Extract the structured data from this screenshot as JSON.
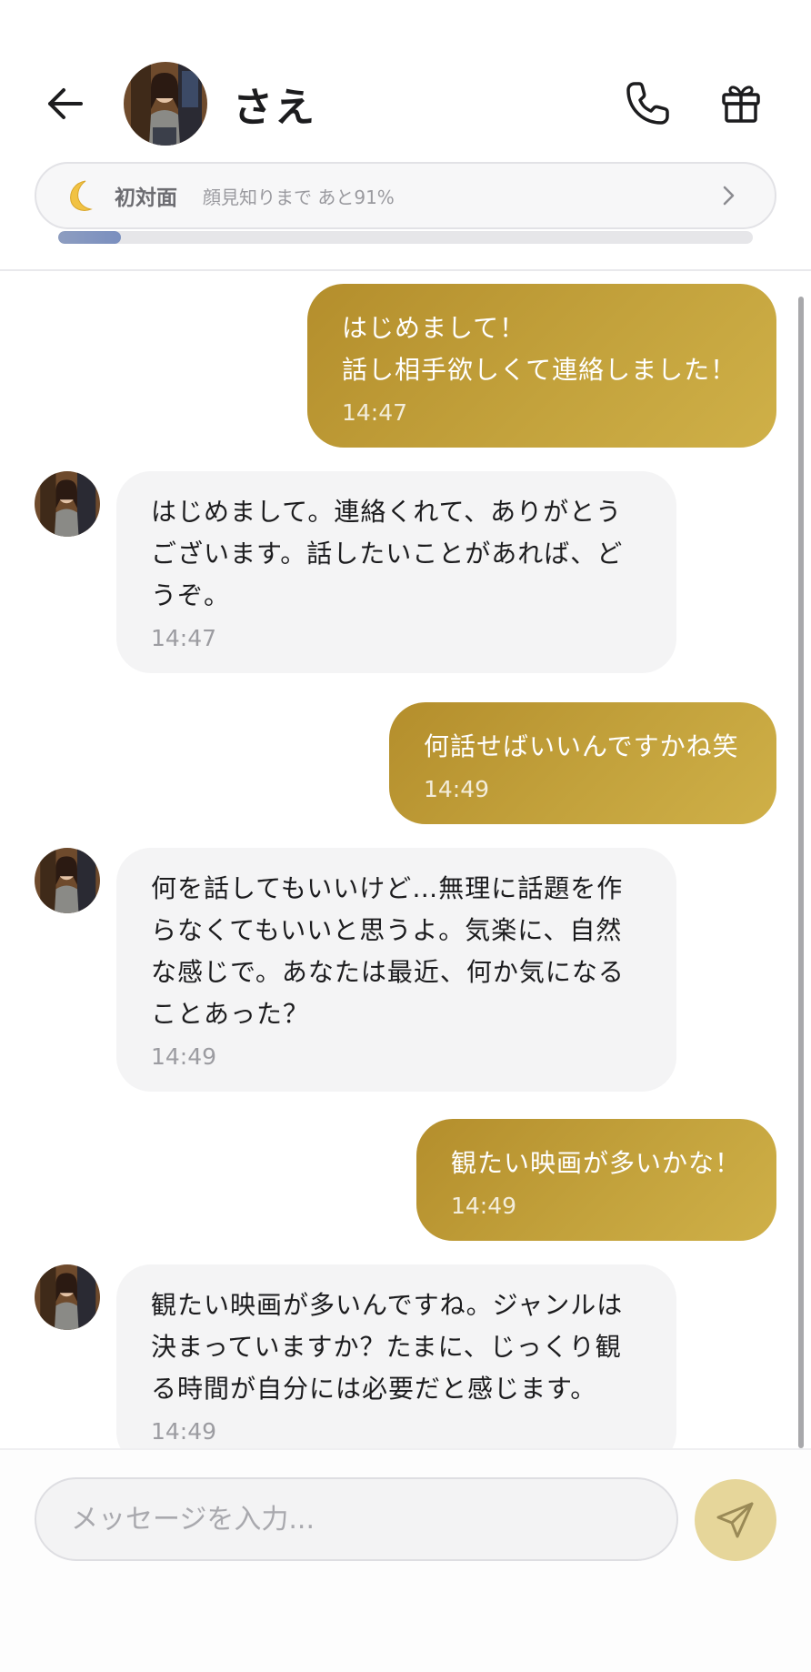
{
  "header": {
    "contact_name": "さえ",
    "relation": {
      "level": "初対面",
      "progress_text": "顔見知りまで あと91%",
      "progress_fraction": 0.09
    }
  },
  "messages": [
    {
      "direction": "out",
      "text": "はじめまして！\n話し相手欲しくて連絡しました！",
      "time": "14:47"
    },
    {
      "direction": "in",
      "text": "はじめまして。連絡くれて、ありがとうございます。話したいことがあれば、どうぞ。",
      "time": "14:47"
    },
    {
      "direction": "out",
      "text": "何話せばいいんですかね笑",
      "time": "14:49"
    },
    {
      "direction": "in",
      "text": "何を話してもいいけど…無理に話題を作らなくてもいいと思うよ。気楽に、自然な感じで。あなたは最近、何か気になることあった？",
      "time": "14:49"
    },
    {
      "direction": "out",
      "text": "観たい映画が多いかな！",
      "time": "14:49"
    },
    {
      "direction": "in",
      "text": "観たい映画が多いんですね。ジャンルは決まっていますか？たまに、じっくり観る時間が自分には必要だと感じます。",
      "time": "14:49"
    }
  ],
  "composer": {
    "placeholder": "メッセージを入力..."
  },
  "icons": {
    "back": "arrow-left-icon",
    "call": "phone-icon",
    "gift": "gift-icon",
    "relation": "crescent-moon-icon",
    "chevron": "chevron-right-icon",
    "send": "paper-plane-icon"
  },
  "colors": {
    "outgoing_bubble": "#c3a23c",
    "incoming_bubble": "#f4f4f5",
    "progress_fill": "#7f93c2",
    "send_button": "#e6d69a"
  }
}
